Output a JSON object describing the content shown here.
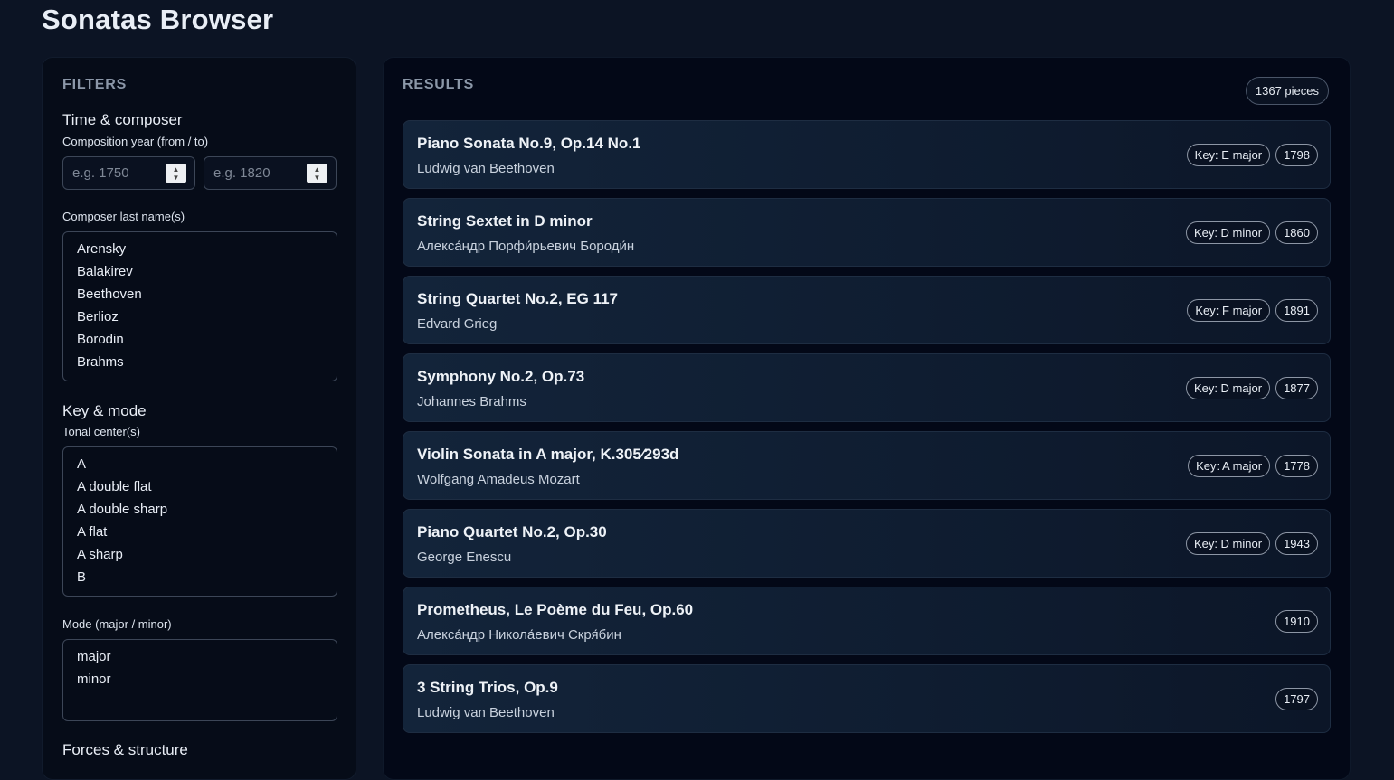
{
  "app": {
    "title": "Sonatas Browser"
  },
  "filters": {
    "heading": "FILTERS",
    "time_section": {
      "title": "Time & composer",
      "year_label": "Composition year (from / to)",
      "year_from_placeholder": "e.g. 1750",
      "year_to_placeholder": "e.g. 1820",
      "composer_label": "Composer last name(s)",
      "composers": [
        "Arensky",
        "Balakirev",
        "Beethoven",
        "Berlioz",
        "Borodin",
        "Brahms"
      ]
    },
    "key_section": {
      "title": "Key & mode",
      "tonal_label": "Tonal center(s)",
      "tonal_centers": [
        "A",
        "A double flat",
        "A double sharp",
        "A flat",
        "A sharp",
        "B"
      ],
      "mode_label": "Mode (major / minor)",
      "modes": [
        "major",
        "minor"
      ]
    },
    "forces_section": {
      "title": "Forces & structure"
    }
  },
  "results": {
    "heading": "RESULTS",
    "count": "1367 pieces",
    "items": [
      {
        "title": "Piano Sonata No.9, Op.14 No.1",
        "composer": "Ludwig van Beethoven",
        "key": "Key: E major",
        "year": "1798"
      },
      {
        "title": "String Sextet in D minor",
        "composer": "Алекса́ндр Порфи́рьевич Бороди́н",
        "key": "Key: D minor",
        "year": "1860"
      },
      {
        "title": "String Quartet No.2, EG 117",
        "composer": "Edvard Grieg",
        "key": "Key: F major",
        "year": "1891"
      },
      {
        "title": "Symphony No.2, Op.73",
        "composer": "Johannes Brahms",
        "key": "Key: D major",
        "year": "1877"
      },
      {
        "title": "Violin Sonata in A major, K.305⁄293d",
        "composer": "Wolfgang Amadeus Mozart",
        "key": "Key: A major",
        "year": "1778"
      },
      {
        "title": "Piano Quartet No.2, Op.30",
        "composer": "George Enescu",
        "key": "Key: D minor",
        "year": "1943"
      },
      {
        "title": "Prometheus, Le Poème du Feu, Op.60",
        "composer": "Алекса́ндр Никола́евич Скря́бин",
        "key": "",
        "year": "1910"
      },
      {
        "title": "3 String Trios, Op.9",
        "composer": "Ludwig van Beethoven",
        "key": "",
        "year": "1797"
      }
    ]
  }
}
